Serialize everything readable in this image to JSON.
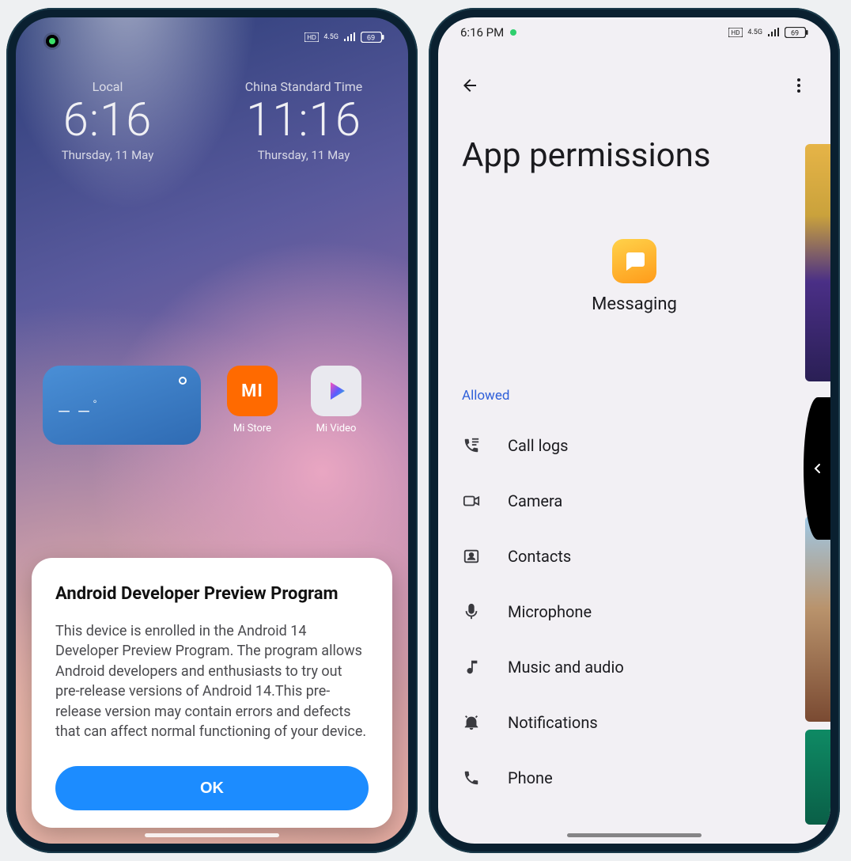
{
  "left": {
    "status": {
      "hd_label": "HD",
      "net_label": "4.5G",
      "battery_text": "69"
    },
    "clocks": [
      {
        "label": "Local",
        "time": "6:16",
        "date": "Thursday, 11 May"
      },
      {
        "label": "China Standard Time",
        "time": "11:16",
        "date": "Thursday, 11 May"
      }
    ],
    "weather": {
      "temp": "– –",
      "deg": "°"
    },
    "apps": [
      {
        "icon": "mi-store",
        "glyph": "MI",
        "label": "Mi Store"
      },
      {
        "icon": "mi-video",
        "glyph": "",
        "label": "Mi Video"
      }
    ],
    "dialog": {
      "title": "Android Developer Preview Program",
      "body": "This device is enrolled in the Android 14 Developer Preview Program. The program allows Android developers and enthusiasts to try out pre-release versions of Android 14.This pre-release version may contain errors and defects that can affect normal functioning of your device.",
      "ok": "OK"
    }
  },
  "right": {
    "status": {
      "time": "6:16 PM",
      "hd_label": "HD",
      "net_label": "4.5G",
      "battery_text": "69"
    },
    "title": "App permissions",
    "app": {
      "name": "Messaging"
    },
    "section_allowed": "Allowed",
    "perms": [
      {
        "icon": "call-logs",
        "label": "Call logs"
      },
      {
        "icon": "camera",
        "label": "Camera"
      },
      {
        "icon": "contacts",
        "label": "Contacts"
      },
      {
        "icon": "mic",
        "label": "Microphone"
      },
      {
        "icon": "audio",
        "label": "Music and audio"
      },
      {
        "icon": "notif",
        "label": "Notifications"
      },
      {
        "icon": "phone",
        "label": "Phone"
      }
    ]
  }
}
